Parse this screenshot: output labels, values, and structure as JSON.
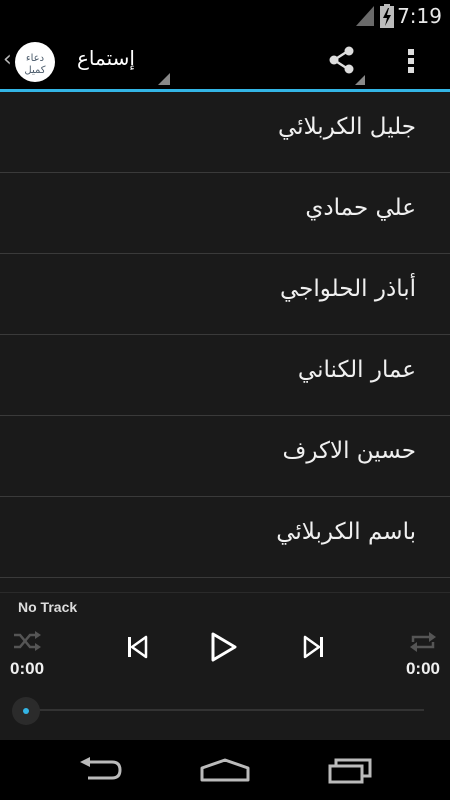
{
  "status_bar": {
    "time": "7:19"
  },
  "action_bar": {
    "title": "إستماع",
    "logo_text": "دعاء كميل",
    "up_icon": "chevron-left-icon",
    "share_icon": "share-icon",
    "overflow_icon": "overflow-menu-icon"
  },
  "list": {
    "items": [
      {
        "label": "جليل الكربلائي"
      },
      {
        "label": "علي حمادي"
      },
      {
        "label": "أباذر الحلواجي"
      },
      {
        "label": "عمار الكناني"
      },
      {
        "label": "حسين الاكرف"
      },
      {
        "label": "باسم الكربلائي"
      }
    ]
  },
  "player": {
    "track": "No Track",
    "elapsed": "0:00",
    "duration": "0:00",
    "progress": 0
  },
  "colors": {
    "accent": "#33b5e5",
    "background": "#1a1a1a",
    "bar": "#000000"
  }
}
